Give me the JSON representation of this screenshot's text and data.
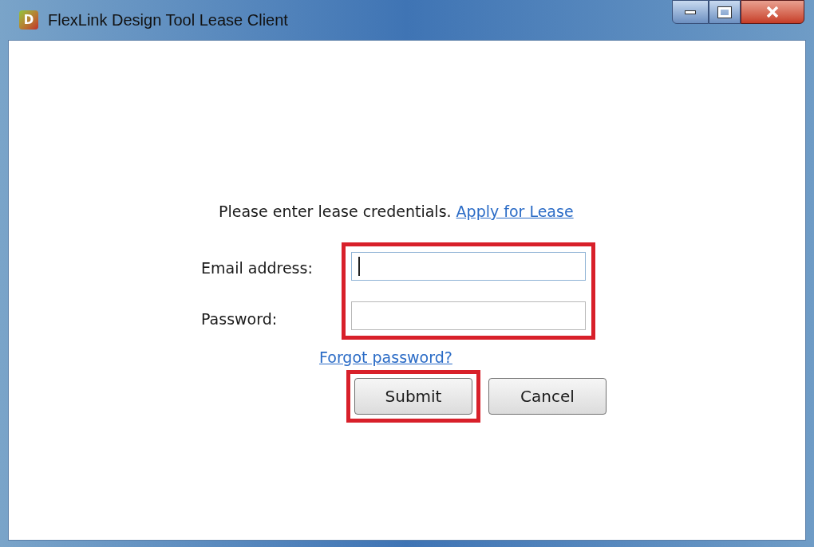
{
  "window": {
    "title": "FlexLink Design Tool Lease Client",
    "app_icon_letter": "D"
  },
  "prompt": {
    "text": "Please enter lease credentials.",
    "link": "Apply for Lease"
  },
  "fields_highlighted": true,
  "fields": [
    {
      "label": "Email address:",
      "focused": true
    },
    {
      "label": "Password:",
      "focused": false
    }
  ],
  "forgot_link": "Forgot password?",
  "buttons": [
    {
      "label": "Submit",
      "highlighted": true
    },
    {
      "label": "Cancel",
      "highlighted": false
    }
  ]
}
